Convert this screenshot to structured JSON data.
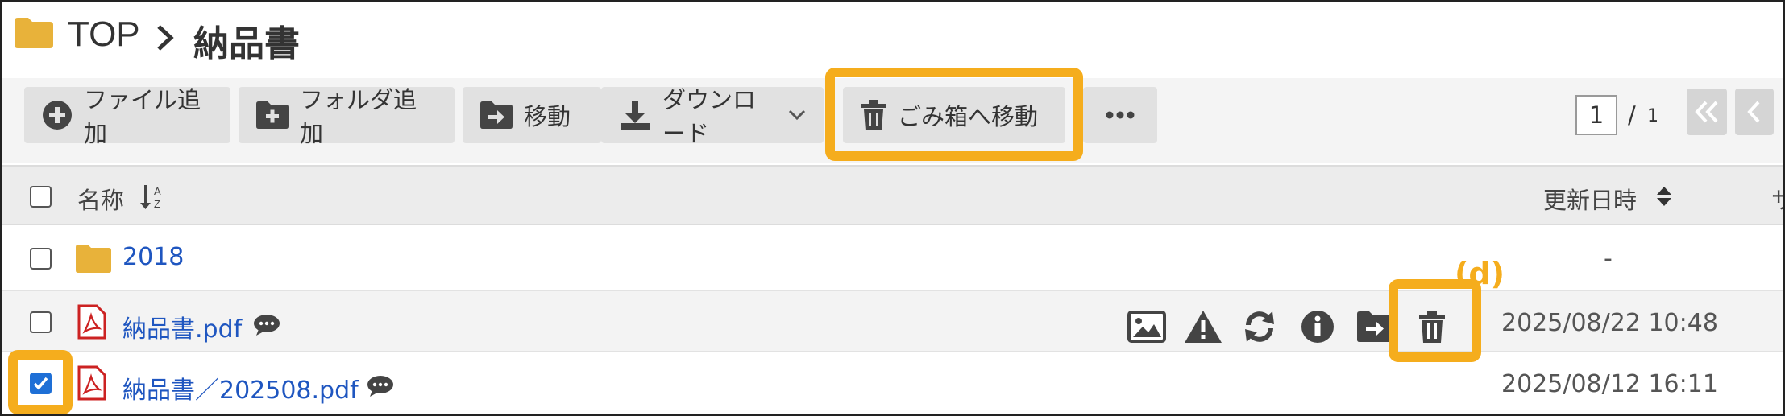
{
  "breadcrumb": {
    "root": "TOP",
    "separator": "›",
    "current": "納品書"
  },
  "toolbar": {
    "add_file": "ファイル追加",
    "add_folder": "フォルダ追加",
    "move": "移動",
    "download": "ダウンロード",
    "trash": "ごみ箱へ移動",
    "more": "•••"
  },
  "pagination": {
    "current": "1",
    "slash": "/",
    "total": "1"
  },
  "table": {
    "header_name": "名称",
    "header_date": "更新日時",
    "header_cut": "サ",
    "rows": [
      {
        "name": "2018",
        "date": "-",
        "type": "folder",
        "checked": false
      },
      {
        "name": "納品書.pdf",
        "date": "2025/08/22 10:48",
        "type": "pdf",
        "checked": false
      },
      {
        "name": "納品書／202508.pdf",
        "date": "2025/08/12 16:11",
        "type": "pdf",
        "checked": true
      }
    ]
  },
  "annotation": {
    "label": "(d)"
  },
  "colors": {
    "highlight": "#f5ad1d",
    "folder": "#e8b23a",
    "pdf": "#cc2222",
    "link": "#1f56c0"
  }
}
